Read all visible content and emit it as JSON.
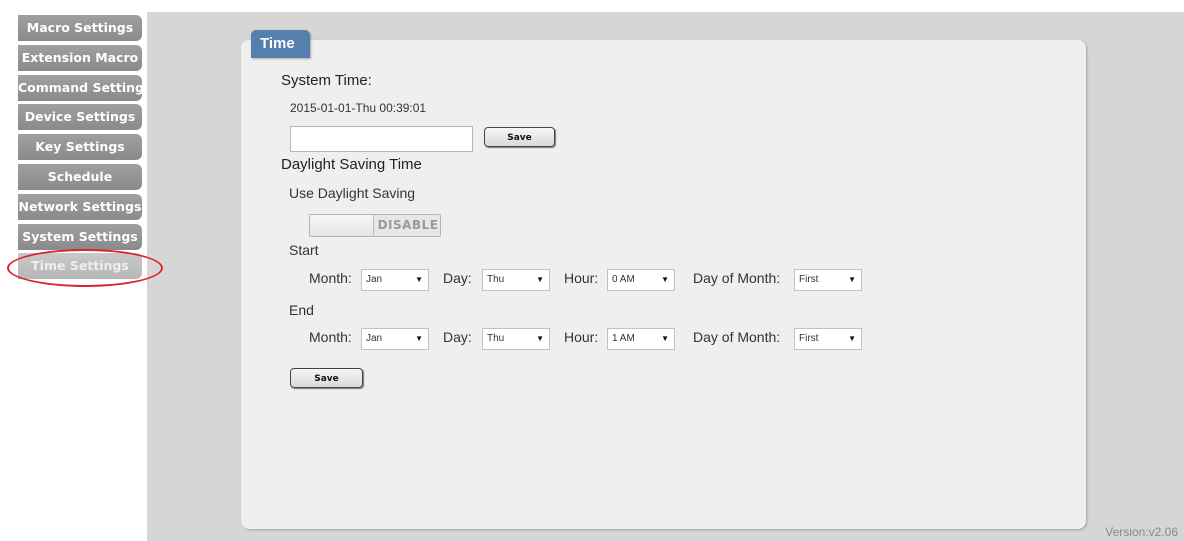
{
  "sidebar": {
    "items": [
      {
        "label": "Macro Settings"
      },
      {
        "label": "Extension Macro"
      },
      {
        "label": "Command Settings"
      },
      {
        "label": "Device Settings"
      },
      {
        "label": "Key Settings"
      },
      {
        "label": "Schedule"
      },
      {
        "label": "Network Settings"
      },
      {
        "label": "System Settings"
      },
      {
        "label": "Time Settings"
      }
    ],
    "active": "Time Settings"
  },
  "panel": {
    "title": "Time",
    "system_time_heading": "System Time:",
    "system_time_value": "2015-01-01-Thu 00:39:01",
    "time_input_value": "",
    "save_label": "Save",
    "dst_heading": "Daylight Saving Time",
    "use_dst_label": "Use Daylight Saving",
    "dst_toggle_label": "DISABLE",
    "start": {
      "heading": "Start",
      "month_label": "Month:",
      "month": "Jan",
      "day_label": "Day:",
      "day": "Thu",
      "hour_label": "Hour:",
      "hour": "0 AM",
      "dom_label": "Day of Month:",
      "dom": "First"
    },
    "end": {
      "heading": "End",
      "month_label": "Month:",
      "month": "Jan",
      "day_label": "Day:",
      "day": "Thu",
      "hour_label": "Hour:",
      "hour": "1 AM",
      "dom_label": "Day of Month:",
      "dom": "First"
    },
    "save2_label": "Save"
  },
  "version": "Version:v2.06",
  "colors": {
    "tab_blue": "#557fae",
    "highlight_red": "#d8252e",
    "sidebar_gray": "#969696"
  },
  "icons": {
    "select_arrow": "dropdown-triangle-icon"
  }
}
